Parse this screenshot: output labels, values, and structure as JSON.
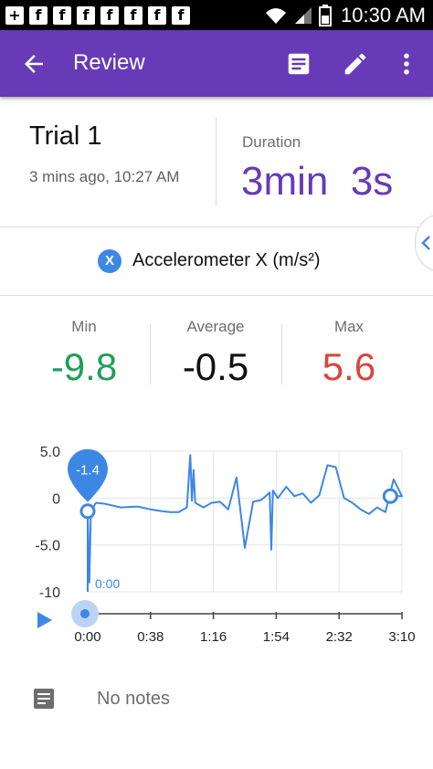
{
  "status_bar": {
    "notification_icons": [
      "plus-icon",
      "facebook-icon",
      "facebook-icon",
      "facebook-icon",
      "facebook-icon",
      "facebook-icon",
      "facebook-icon",
      "facebook-icon"
    ],
    "time": "10:30 AM"
  },
  "app_bar": {
    "title": "Review",
    "back_icon": "arrow-back-icon",
    "notes_icon": "notes-icon",
    "edit_icon": "edit-icon",
    "more_icon": "more-vert-icon",
    "color": "#673ab7"
  },
  "trial": {
    "name": "Trial 1",
    "timestamp": "3 mins ago, 10:27 AM",
    "duration_label": "Duration",
    "duration_value": "3min  3s"
  },
  "sensor": {
    "badge": "X",
    "label": "Accelerometer X (m/s²)"
  },
  "stats": {
    "min_label": "Min",
    "min_value": "-9.8",
    "min_color": "#1e9e5a",
    "avg_label": "Average",
    "avg_value": "-0.5",
    "max_label": "Max",
    "max_value": "5.6",
    "max_color": "#d9463b"
  },
  "chart_data": {
    "type": "line",
    "series": [
      {
        "x": [
          0,
          1,
          2,
          3,
          4,
          5,
          10,
          20,
          30,
          38,
          45,
          50,
          55,
          60,
          62,
          63,
          64,
          65,
          70,
          75,
          80,
          85,
          90,
          95,
          100,
          105,
          110,
          111,
          112,
          115,
          120,
          125,
          130,
          135,
          140,
          145,
          150,
          155,
          160,
          165,
          170,
          175,
          180,
          185,
          190,
          183
        ],
        "y": [
          -1.4,
          -9.0,
          -1.0,
          -1.2,
          -0.8,
          -0.5,
          -0.6,
          -1.0,
          -0.9,
          -1.2,
          -1.4,
          -1.5,
          -1.5,
          -1.0,
          4.6,
          -0.3,
          3.0,
          -0.5,
          -1.0,
          -0.5,
          -0.4,
          -1.2,
          2.2,
          -5.3,
          -0.4,
          -0.2,
          0.6,
          -5.5,
          0.8,
          0.0,
          1.2,
          0.2,
          0.5,
          -0.5,
          0.3,
          3.5,
          3.3,
          0.0,
          -0.5,
          -1.2,
          -1.7,
          -1.0,
          -1.5,
          2.0,
          0.2,
          0.2
        ]
      }
    ],
    "x_ticks": [
      "0:00",
      "0:38",
      "1:16",
      "1:54",
      "2:32",
      "3:10"
    ],
    "y_ticks": [
      "5.0",
      "0",
      "-5.0",
      "-10"
    ],
    "xlim": [
      0,
      190
    ],
    "ylim": [
      -10,
      5
    ],
    "grid": true,
    "line_color": "#3d87e4",
    "marker_value": "-1.4",
    "cursor_time": "0:00"
  },
  "notes": {
    "text": "No notes"
  }
}
